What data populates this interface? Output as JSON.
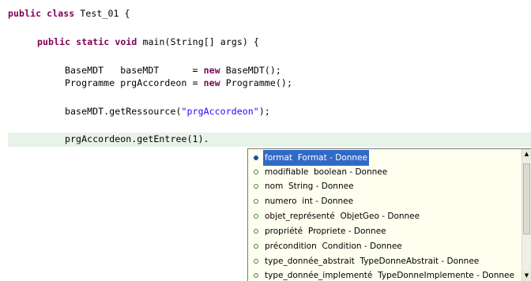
{
  "code": {
    "class_decl": {
      "kw": "public class",
      "rest": " Test_01 {"
    },
    "method_decl": {
      "kw": "public static void",
      "rest": " main(String[] args) {"
    },
    "line_basemdt": {
      "a": "BaseMDT   baseMDT      = ",
      "kw": "new",
      "b": " BaseMDT();"
    },
    "line_programme": {
      "a": "Programme prgAccordeon = ",
      "kw": "new",
      "b": " Programme();"
    },
    "line_getressource": {
      "a": "baseMDT.getRessource(",
      "str": "\"prgAccordeon\"",
      "b": ");"
    },
    "line_current": "prgAccordeon.getEntree(1)."
  },
  "completion": {
    "proposals": [
      {
        "name": "format",
        "detail": "Format - Donnee",
        "selected": true
      },
      {
        "name": "modifiable",
        "detail": "boolean - Donnee"
      },
      {
        "name": "nom",
        "detail": "String - Donnee"
      },
      {
        "name": "numero",
        "detail": "int - Donnee"
      },
      {
        "name": "objet_représenté",
        "detail": "ObjetGeo - Donnee"
      },
      {
        "name": "propriété",
        "detail": "Propriete - Donnee"
      },
      {
        "name": "précondition",
        "detail": "Condition - Donnee"
      },
      {
        "name": "type_donnée_abstrait",
        "detail": "TypeDonneAbstrait - Donnee"
      },
      {
        "name": "type_donnée_implementé",
        "detail": "TypeDonneImplemente - Donnee"
      }
    ],
    "scroll_up_icon": "▲",
    "scroll_down_icon": "▼"
  },
  "colors": {
    "keyword": "#7f0055",
    "string": "#2a00ff",
    "current_line": "#e8f2e8",
    "popup_bg": "#fffff0",
    "selection": "#316ac5"
  }
}
